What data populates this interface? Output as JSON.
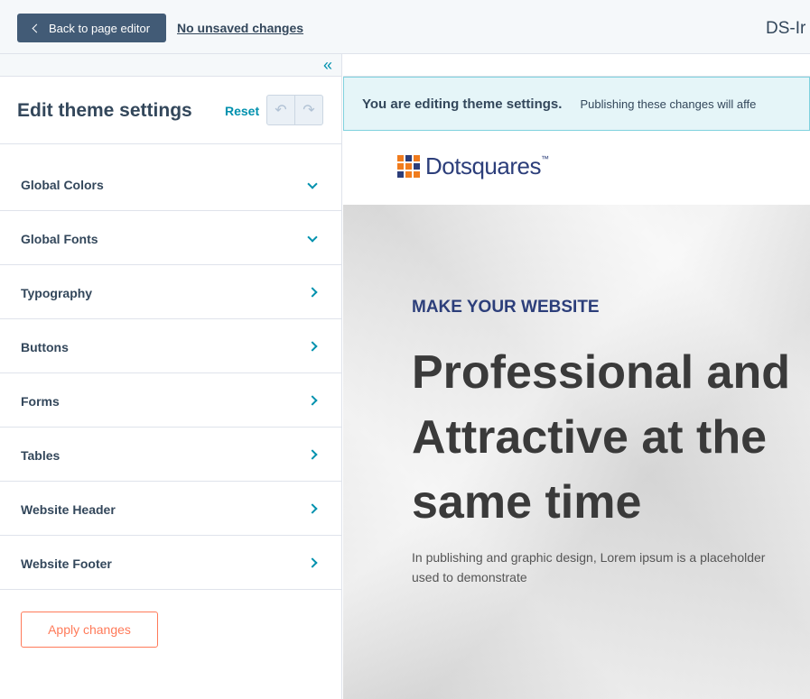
{
  "topbar": {
    "back_label": "Back to page editor",
    "unsaved_label": "No unsaved changes",
    "page_name": "DS-Ir"
  },
  "panel": {
    "title": "Edit theme settings",
    "reset_label": "Reset",
    "sections": [
      {
        "label": "Global Colors",
        "expanded": true
      },
      {
        "label": "Global Fonts",
        "expanded": true
      },
      {
        "label": "Typography",
        "expanded": false
      },
      {
        "label": "Buttons",
        "expanded": false
      },
      {
        "label": "Forms",
        "expanded": false
      },
      {
        "label": "Tables",
        "expanded": false
      },
      {
        "label": "Website Header",
        "expanded": false
      },
      {
        "label": "Website Footer",
        "expanded": false
      }
    ],
    "apply_label": "Apply changes"
  },
  "preview": {
    "banner_strong": "You are editing theme settings.",
    "banner_text": "Publishing these changes will affe",
    "logo_text": "Dotsquares",
    "logo_tm": "™",
    "hero_eyebrow": "MAKE YOUR WEBSITE",
    "hero_title": "Professional and\nAttractive at the\nsame time",
    "hero_body": "In publishing and graphic design, Lorem ipsum is a placeholder\nused to demonstrate"
  },
  "colors": {
    "accent": "#0091ae",
    "primary_dark": "#425b76",
    "cta": "#ff7a59",
    "logo_blue": "#2c3e7a",
    "logo_orange": "#f07c1e"
  }
}
